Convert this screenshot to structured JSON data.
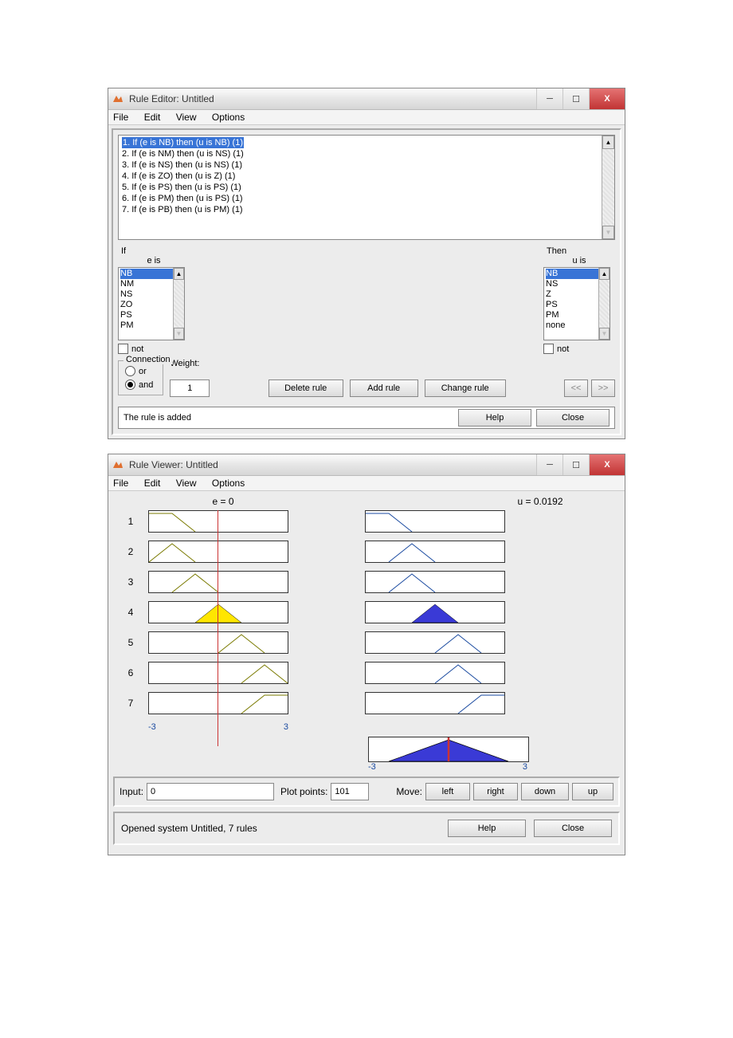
{
  "editor": {
    "title": "Rule Editor: Untitled",
    "menu": [
      "File",
      "Edit",
      "View",
      "Options"
    ],
    "rules": [
      "1. If (e is NB) then (u is NB) (1)",
      "2. If (e is NM) then (u is NS) (1)",
      "3. If (e is NS) then (u is NS) (1)",
      "4. If (e is ZO) then (u is Z) (1)",
      "5. If (e is PS) then (u is PS) (1)",
      "6. If (e is PM) then (u is PS) (1)",
      "7. If (e is PB) then (u is PM) (1)"
    ],
    "selected_rule_index": 0,
    "if_label": "If",
    "then_label": "Then",
    "if_var": "e is",
    "then_var": "u is",
    "if_opts": [
      "NB",
      "NM",
      "NS",
      "ZO",
      "PS",
      "PM"
    ],
    "if_sel": 0,
    "then_opts": [
      "NB",
      "NS",
      "Z",
      "PS",
      "PM",
      "none"
    ],
    "then_sel": 0,
    "not_label": "not",
    "connection_label": "Connection",
    "or_label": "or",
    "and_label": "and",
    "connection": "and",
    "weight_label": "Weight:",
    "weight": "1",
    "delete_rule": "Delete rule",
    "add_rule": "Add rule",
    "change_rule": "Change rule",
    "prev": "<<",
    "next": ">>",
    "status": "The rule is added",
    "help": "Help",
    "close": "Close"
  },
  "viewer": {
    "title": "Rule Viewer: Untitled",
    "menu": [
      "File",
      "Edit",
      "View",
      "Options"
    ],
    "e_header": "e = 0",
    "u_header": "u = 0.0192",
    "row_labels": [
      "1",
      "2",
      "3",
      "4",
      "5",
      "6",
      "7"
    ],
    "axis_min": "-3",
    "axis_max": "3",
    "input_label": "Input:",
    "input_value": "0",
    "plot_points_label": "Plot points:",
    "plot_points": "101",
    "move_label": "Move:",
    "left": "left",
    "right": "right",
    "down": "down",
    "up": "up",
    "status": "Opened system Untitled, 7 rules",
    "help": "Help",
    "close": "Close"
  },
  "chart_data": {
    "type": "area",
    "input_variable": "e",
    "input_value": 0,
    "input_range": [
      -3,
      3
    ],
    "output_variable": "u",
    "output_value": 0.0192,
    "output_range": [
      -3,
      3
    ],
    "rules": [
      {
        "idx": 1,
        "e_mf": {
          "shape": "left-shoulder",
          "points": [
            -3,
            -2,
            -1
          ],
          "fill": 0
        },
        "u_mf": {
          "shape": "left-shoulder",
          "points": [
            -3,
            -2,
            -1
          ],
          "fill": 0
        }
      },
      {
        "idx": 2,
        "e_mf": {
          "shape": "triangle",
          "points": [
            -3,
            -2,
            -1
          ],
          "fill": 0
        },
        "u_mf": {
          "shape": "triangle",
          "points": [
            -2,
            -1,
            0
          ],
          "fill": 0
        }
      },
      {
        "idx": 3,
        "e_mf": {
          "shape": "triangle",
          "points": [
            -2,
            -1,
            0
          ],
          "fill": 0
        },
        "u_mf": {
          "shape": "triangle",
          "points": [
            -2,
            -1,
            0
          ],
          "fill": 0
        }
      },
      {
        "idx": 4,
        "e_mf": {
          "shape": "triangle",
          "points": [
            -1,
            0,
            1
          ],
          "fill": 1,
          "color": "#ffe600"
        },
        "u_mf": {
          "shape": "triangle",
          "points": [
            -1,
            0,
            1
          ],
          "fill": 1,
          "color": "#3a3ad6"
        }
      },
      {
        "idx": 5,
        "e_mf": {
          "shape": "triangle",
          "points": [
            0,
            1,
            2
          ],
          "fill": 0
        },
        "u_mf": {
          "shape": "triangle",
          "points": [
            0,
            1,
            2
          ],
          "fill": 0
        }
      },
      {
        "idx": 6,
        "e_mf": {
          "shape": "triangle",
          "points": [
            1,
            2,
            3
          ],
          "fill": 0
        },
        "u_mf": {
          "shape": "triangle",
          "points": [
            0,
            1,
            2
          ],
          "fill": 0
        }
      },
      {
        "idx": 7,
        "e_mf": {
          "shape": "right-shoulder",
          "points": [
            1,
            2,
            3
          ],
          "fill": 0
        },
        "u_mf": {
          "shape": "right-shoulder",
          "points": [
            1,
            2,
            3
          ],
          "fill": 0
        }
      }
    ],
    "aggregate": {
      "shape": "triangle",
      "points": [
        -1.5,
        0,
        1.5
      ],
      "fill": 1,
      "color": "#3a3ad6",
      "centroid_line": 0.0192
    }
  }
}
